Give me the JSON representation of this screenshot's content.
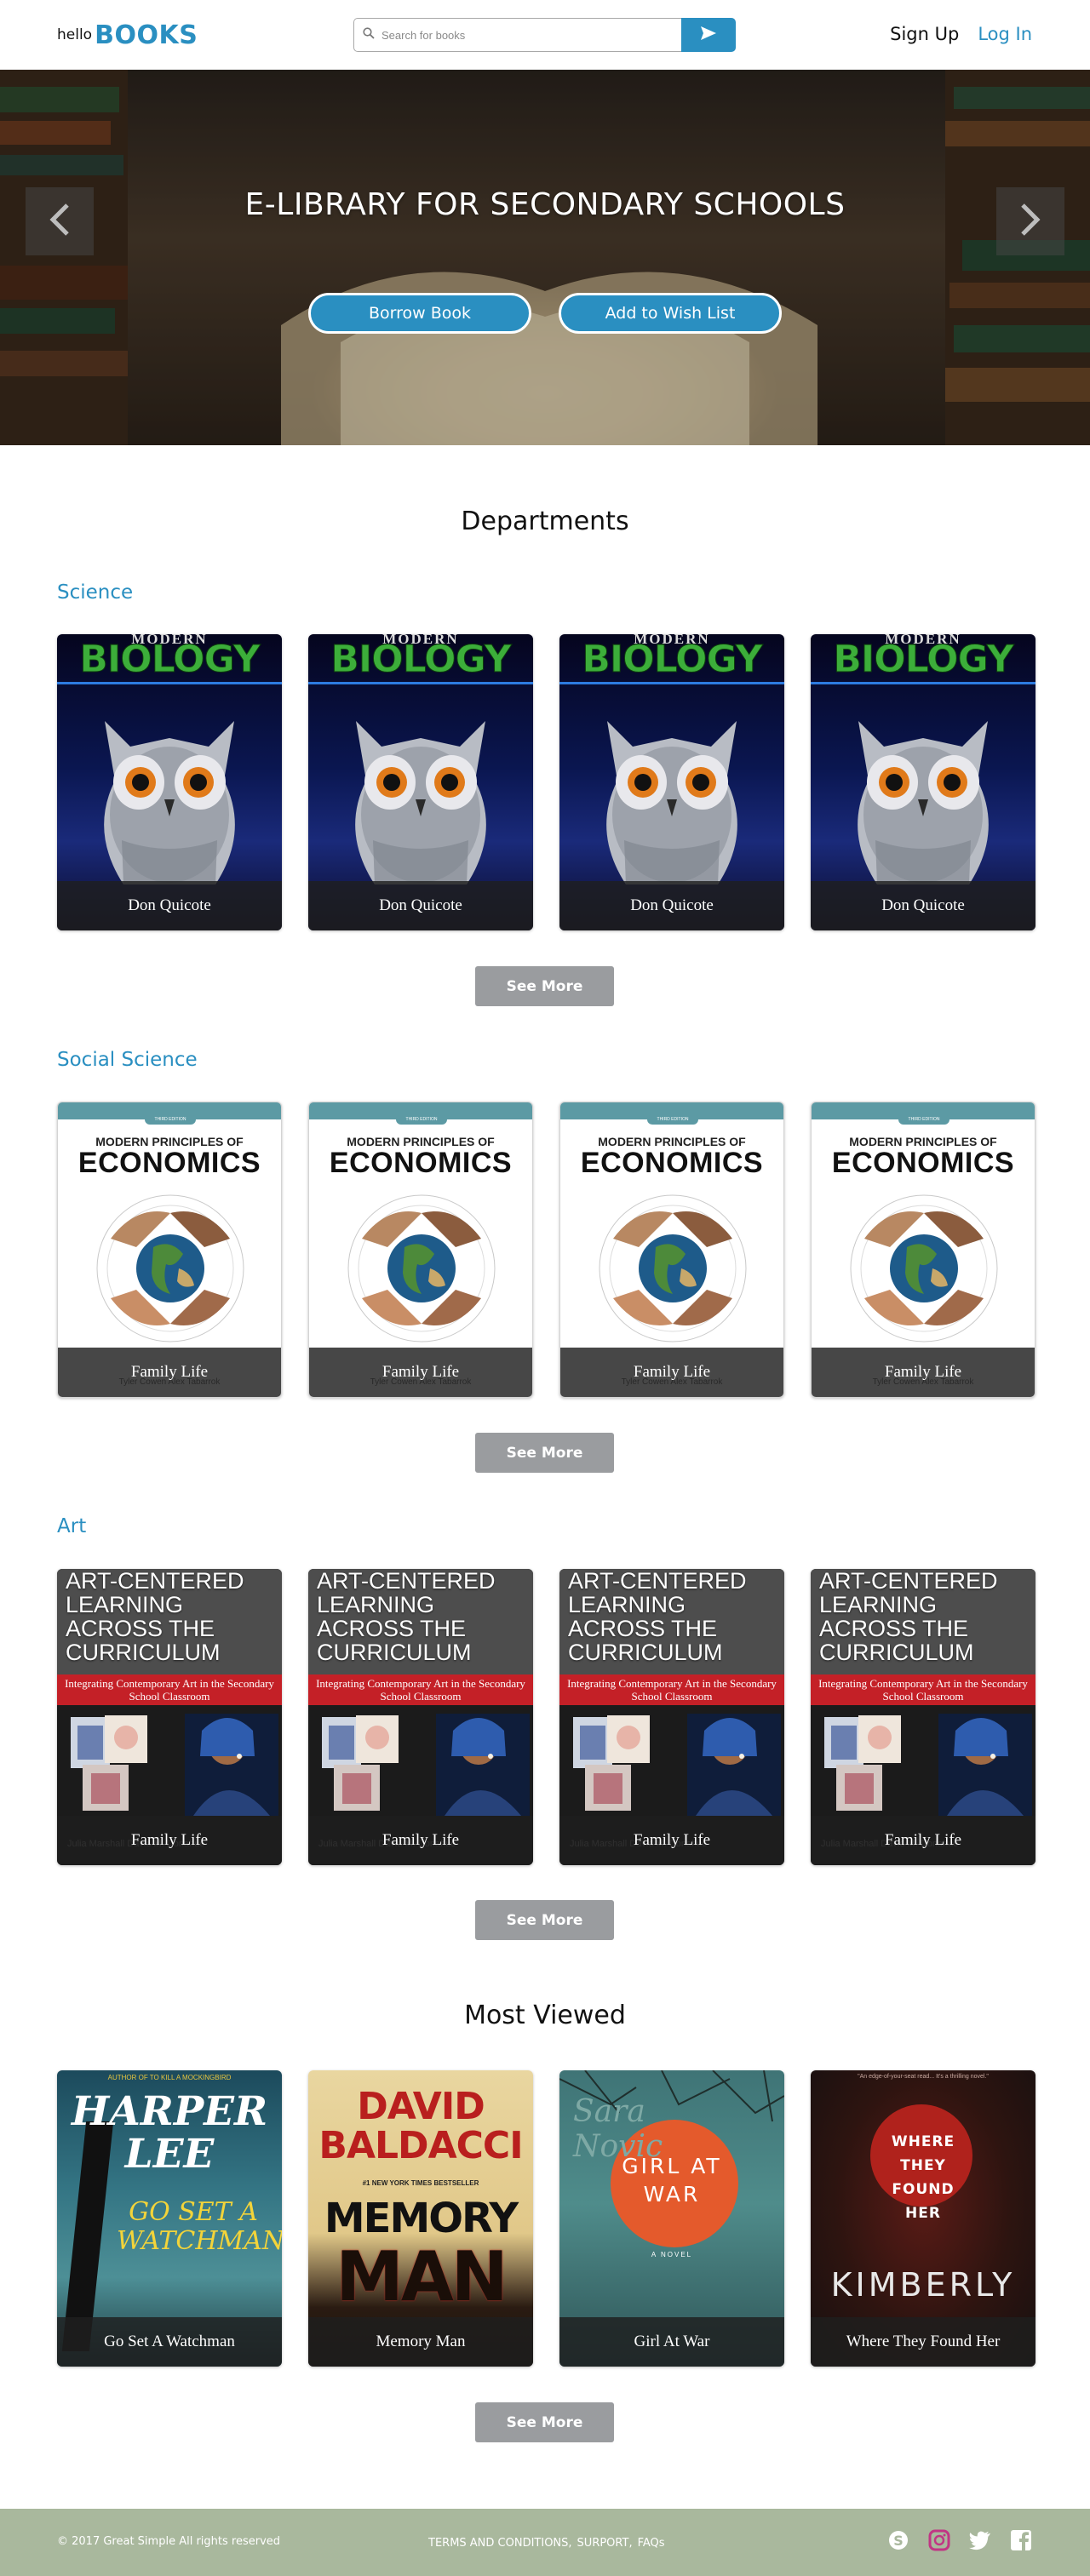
{
  "header": {
    "logo_small": "hello",
    "logo_big": "BOOKS",
    "search_placeholder": "Search for books",
    "signup": "Sign Up",
    "login": "Log In"
  },
  "hero": {
    "title": "E-LIBRARY FOR SECONDARY SCHOOLS",
    "borrow": "Borrow Book",
    "wish": "Add to Wish List"
  },
  "departments": {
    "heading": "Departments",
    "see_more": "See More",
    "sections": [
      {
        "name": "Science",
        "cover_type": "biology",
        "cover_text": {
          "top": "MODERN",
          "word": "BIOLOGY"
        },
        "books": [
          "Don Quicote",
          "Don Quicote",
          "Don Quicote",
          "Don Quicote"
        ]
      },
      {
        "name": "Social Science",
        "cover_type": "economics",
        "cover_text": {
          "edition": "THIRD EDITION",
          "line1": "MODERN PRINCIPLES OF",
          "line2": "ECONOMICS",
          "authors": "Tyler Cowen  Alex Tabarrok"
        },
        "books": [
          "Family Life",
          "Family Life",
          "Family Life",
          "Family Life"
        ]
      },
      {
        "name": "Art",
        "cover_type": "art",
        "cover_text": {
          "title": "ART-CENTERED LEARNING ACROSS THE CURRICULUM",
          "subtitle": "Integrating Contemporary Art in the Secondary School Classroom",
          "authors": "Julia Marshall  David M. Donahue"
        },
        "books": [
          "Family Life",
          "Family Life",
          "Family Life",
          "Family Life"
        ]
      }
    ]
  },
  "most_viewed": {
    "heading": "Most Viewed",
    "see_more": "See More",
    "books": [
      {
        "caption": "Go Set A Watchman",
        "c1": "HARPER LEE",
        "c2": "GO SET A WATCHMAN",
        "c3": "AUTHOR OF TO KILL A MOCKINGBIRD"
      },
      {
        "caption": "Memory Man",
        "c1": "DAVID BALDACCI",
        "c2": "MEMORY",
        "c3": "MAN",
        "c4": "#1 NEW YORK TIMES BESTSELLER"
      },
      {
        "caption": "Girl At War",
        "c1": "GIRL AT WAR",
        "c2": "A NOVEL",
        "c3": "Sara Novic"
      },
      {
        "caption": "Where They Found Her",
        "c1": "WHERE THEY FOUND HER",
        "c2": "KIMBERLY",
        "c3": "\"An edge-of-your-seat read... It's a thrilling novel.\""
      }
    ]
  },
  "footer": {
    "copyright": "© 2017 Great Simple All rights reserved",
    "link1": "TERMS AND CONDITIONS,",
    "link2": "SURPORT,",
    "link3": "FAQs",
    "social": [
      "skype-icon",
      "instagram-icon",
      "twitter-icon",
      "facebook-icon"
    ]
  },
  "colors": {
    "accent": "#2a8fc1",
    "footer": "#a9b89d",
    "button_gray": "#9a9c9f"
  }
}
